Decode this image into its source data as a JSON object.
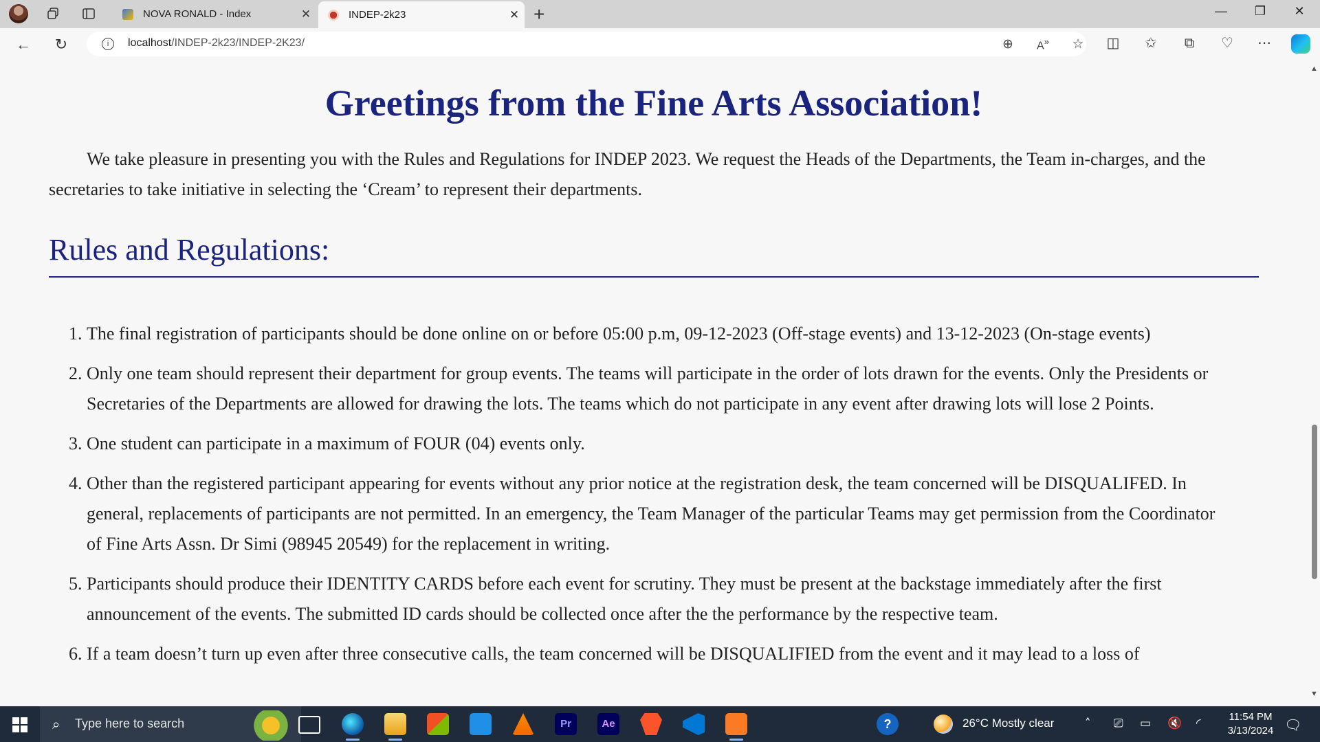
{
  "browser": {
    "tabs": [
      {
        "title": "NOVA RONALD - Index",
        "active": false
      },
      {
        "title": "INDEP-2k23",
        "active": true
      }
    ],
    "url_host": "localhost",
    "url_path": "/INDEP-2k23/INDEP-2K23/"
  },
  "page": {
    "heading": "Greetings from the Fine Arts Association!",
    "intro": "We take pleasure in presenting you with the Rules and Regulations for INDEP 2023. We request the Heads of the Departments, the Team in-charges, and the secretaries to take initiative in selecting the ‘Cream’ to represent their departments.",
    "rules_heading": "Rules and Regulations:",
    "rules": [
      "The final registration of participants should be done online on or before 05:00 p.m, 09-12-2023 (Off-stage events) and 13-12-2023 (On-stage events)",
      "Only one team should represent their department for group events. The teams will participate in the order of lots drawn for the events. Only the Presidents or Secretaries of the Departments are allowed for drawing the lots. The teams which do not participate in any event after drawing lots will lose 2 Points.",
      "One student can participate in a maximum of FOUR (04) events only.",
      "Other than the registered participant appearing for events without any prior notice at the registration desk, the team concerned will be DISQUALIFED. In general, replacements of participants are not permitted. In an emergency, the Team Manager of the particular Teams may get permission from the Coordinator of Fine Arts Assn. Dr Simi (98945 20549) for the replacement in writing.",
      "Participants should produce their IDENTITY CARDS before each event for scrutiny. They must be present at the backstage immediately after the first announcement of the events. The submitted ID cards should be collected once after the the performance by the respective team.",
      "If a team doesn’t turn up even after three consecutive calls, the team concerned will be DISQUALIFIED from the event and it may lead to a loss of"
    ]
  },
  "taskbar": {
    "search_placeholder": "Type here to search",
    "weather": "26°C  Mostly clear",
    "time": "11:54 PM",
    "date": "3/13/2024"
  },
  "colors": {
    "heading": "#1a237e",
    "body_text": "#222222",
    "page_bg": "#f7f7f7",
    "tabstrip_bg": "#d3d3d3",
    "taskbar_bg": "#1f2b3a"
  }
}
